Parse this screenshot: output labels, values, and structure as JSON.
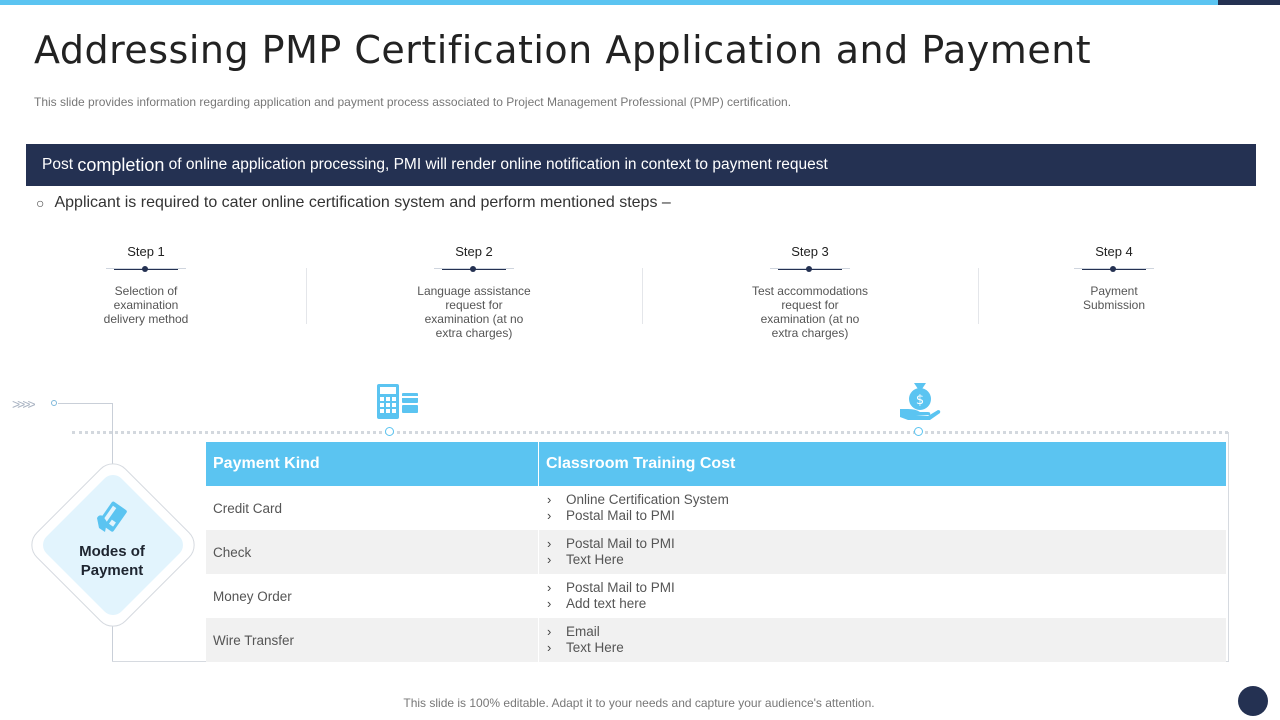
{
  "colors": {
    "accent": "#5bc4f1",
    "dark": "#243152"
  },
  "title": "Addressing PMP Certification Application and Payment",
  "subtitle": "This slide provides  information  regarding  application  and payment  process associated to Project  Management  Professional  (PMP) certification.",
  "banner": {
    "prefix": "Post ",
    "emphasis": "completion",
    "suffix": " of online application processing, PMI will render online notification in context to payment request"
  },
  "bullet": "Applicant is required to cater online certification system and perform mentioned steps –",
  "steps": [
    {
      "title": "Step 1",
      "desc": "Selection of examination delivery method"
    },
    {
      "title": "Step 2",
      "desc": "Language assistance request for examination (at no extra charges)"
    },
    {
      "title": "Step 3",
      "desc": "Test accommodations request for examination (at no extra charges)"
    },
    {
      "title": "Step 4",
      "desc": "Payment Submission"
    }
  ],
  "icons": {
    "calculator": "calculator-icon",
    "money": "money-bag-hand-icon",
    "payment": "card-hand-icon"
  },
  "modes_label": "Modes of Payment",
  "table": {
    "headers": [
      "Payment Kind",
      "Classroom Training Cost"
    ],
    "rows": [
      {
        "kind": "Credit Card",
        "items": [
          "Online Certification  System",
          "Postal Mail to PMI"
        ]
      },
      {
        "kind": "Check",
        "items": [
          "Postal Mail to PMI",
          "Text Here"
        ]
      },
      {
        "kind": "Money Order",
        "items": [
          "Postal Mail to PMI",
          "Add text here"
        ]
      },
      {
        "kind": "Wire Transfer",
        "items": [
          "Email",
          "Text Here"
        ]
      }
    ]
  },
  "footer": "This slide is 100% editable. Adapt it to your needs and capture your audience's attention."
}
